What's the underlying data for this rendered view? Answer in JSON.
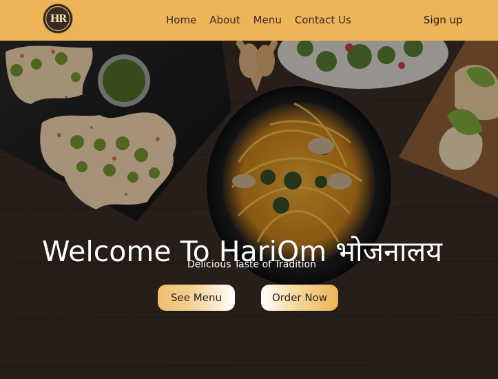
{
  "brand": {
    "logo_text": "HR",
    "logo_icon": "hr-monogram-logo"
  },
  "nav": {
    "items": [
      {
        "label": "Home"
      },
      {
        "label": "About"
      },
      {
        "label": "Menu"
      },
      {
        "label": "Contact Us"
      }
    ],
    "signup": "Sign up"
  },
  "hero": {
    "title": "Welcome To HariOm भोजनालय",
    "subtitle": "Delicious Taste of Tradition",
    "buttons": {
      "see_menu": "See Menu",
      "order_now": "Order Now"
    }
  },
  "colors": {
    "accent": "#edb458",
    "navbar_text": "#3d2f27",
    "hero_text": "#ffffff"
  }
}
